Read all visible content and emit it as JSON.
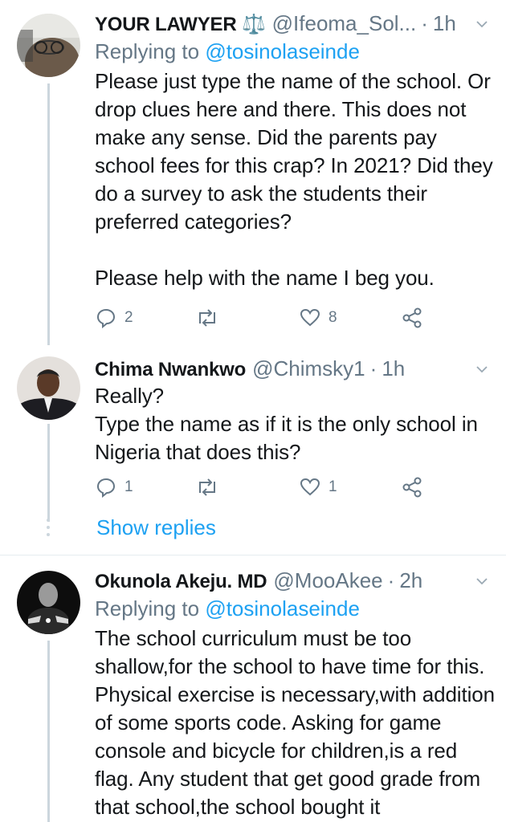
{
  "tweets": [
    {
      "name": "YOUR LAWYER ⚖️",
      "handle": "@Ifeoma_Sol...",
      "dot": "·",
      "time": "1h",
      "replying_prefix": "Replying to ",
      "replying_to": "@tosinolaseinde",
      "text": "Please just type the name of the school. Or drop clues here and there. This does not make any sense. Did the parents pay school fees for this crap? In 2021? Did they do a survey to ask the students their preferred categories?\n\nPlease help with the name I beg you.",
      "replies": "2",
      "retweets": "",
      "likes": "8"
    },
    {
      "name": "Chima Nwankwo",
      "handle": "@Chimsky1",
      "dot": "·",
      "time": "1h",
      "text": "Really?\nType the name as if it is the only school in Nigeria that does this?",
      "replies": "1",
      "retweets": "",
      "likes": "1"
    },
    {
      "name": "Okunola Akeju. MD",
      "handle": "@MooAkee",
      "dot": "·",
      "time": "2h",
      "replying_prefix": "Replying to ",
      "replying_to": "@tosinolaseinde",
      "text": "The school curriculum must be too shallow,for the school to have time for this. Physical exercise is necessary,with addition of some sports code. Asking for game console and bicycle for children,is a red flag. Any student that get good grade from that school,the school bought it"
    }
  ],
  "show_replies": "Show replies",
  "colors": {
    "link": "#1da1f2",
    "muted": "#657786",
    "text": "#14171a",
    "line": "#ccd6dd"
  }
}
